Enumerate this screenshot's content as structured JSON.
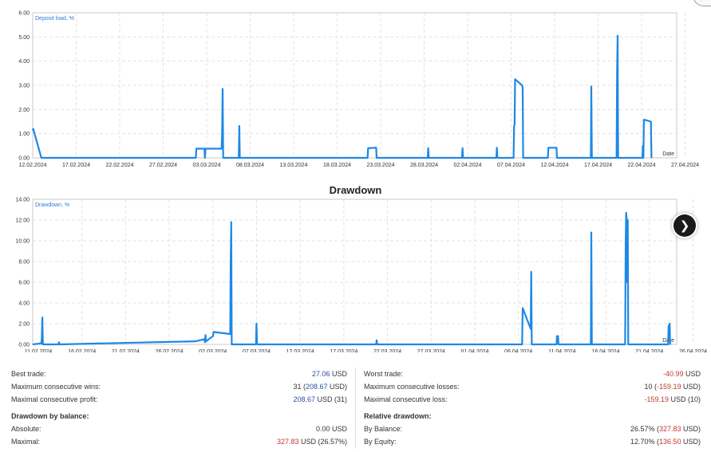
{
  "charts": {
    "deposit_load": {
      "series_label": "Deposit load, %",
      "x_axis_label": "Date",
      "y_ticks": [
        "0.00",
        "1.00",
        "2.00",
        "3.00",
        "4.00",
        "5.00",
        "6.00"
      ],
      "x_ticks": [
        "12.02.2024",
        "17.02.2024",
        "22.02.2024",
        "27.02.2024",
        "03.03.2024",
        "08.03.2024",
        "13.03.2024",
        "18.03.2024",
        "23.03.2024",
        "28.03.2024",
        "02.04.2024",
        "07.04.2024",
        "12.04.2024",
        "17.04.2024",
        "22.04.2024",
        "27.04.2024"
      ]
    },
    "drawdown": {
      "title": "Drawdown",
      "series_label": "Drawdown, %",
      "x_axis_label": "Date",
      "y_ticks": [
        "0.00",
        "2.00",
        "4.00",
        "6.00",
        "8.00",
        "10.00",
        "12.00",
        "14.00"
      ],
      "x_ticks": [
        "11.02.2024",
        "16.02.2024",
        "21.02.2024",
        "26.02.2024",
        "02.03.2024",
        "07.03.2024",
        "12.03.2024",
        "17.03.2024",
        "22.03.2024",
        "27.03.2024",
        "01.04.2024",
        "06.04.2024",
        "11.04.2024",
        "16.04.2024",
        "21.04.2024",
        "26.04.2024"
      ]
    }
  },
  "chart_data": [
    {
      "type": "line",
      "title": "",
      "series": [
        {
          "name": "Deposit load, %",
          "points": [
            [
              "12.02.2024",
              1.15
            ],
            [
              "12.02.2024",
              1.2
            ],
            [
              "13.02.2024",
              0.0
            ],
            [
              "02.03.2024",
              0.0
            ],
            [
              "02.03.2024",
              0.38
            ],
            [
              "03.03.2024",
              0.38
            ],
            [
              "03.03.2024",
              0.0
            ],
            [
              "03.03.2024",
              0.38
            ],
            [
              "05.03.2024",
              0.38
            ],
            [
              "05.03.2024",
              1.1
            ],
            [
              "05.03.2024",
              2.85
            ],
            [
              "05.03.2024",
              0.0
            ],
            [
              "07.03.2024",
              0.0
            ],
            [
              "07.03.2024",
              1.32
            ],
            [
              "07.03.2024",
              0.0
            ],
            [
              "22.03.2024",
              0.0
            ],
            [
              "22.03.2024",
              0.4
            ],
            [
              "23.03.2024",
              0.42
            ],
            [
              "23.03.2024",
              0.0
            ],
            [
              "29.03.2024",
              0.0
            ],
            [
              "29.03.2024",
              0.4
            ],
            [
              "29.03.2024",
              0.0
            ],
            [
              "02.04.2024",
              0.0
            ],
            [
              "02.04.2024",
              0.4
            ],
            [
              "02.04.2024",
              0.0
            ],
            [
              "06.04.2024",
              0.0
            ],
            [
              "06.04.2024",
              0.42
            ],
            [
              "06.04.2024",
              0.0
            ],
            [
              "08.04.2024",
              0.0
            ],
            [
              "08.04.2024",
              1.3
            ],
            [
              "08.04.2024",
              1.38
            ],
            [
              "08.04.2024",
              3.25
            ],
            [
              "09.04.2024",
              3.0
            ],
            [
              "09.04.2024",
              2.9
            ],
            [
              "09.04.2024",
              0.0
            ],
            [
              "12.04.2024",
              0.0
            ],
            [
              "12.04.2024",
              0.42
            ],
            [
              "13.04.2024",
              0.42
            ],
            [
              "13.04.2024",
              0.0
            ],
            [
              "17.04.2024",
              0.0
            ],
            [
              "17.04.2024",
              2.95
            ],
            [
              "17.04.2024",
              0.0
            ],
            [
              "20.04.2024",
              0.0
            ],
            [
              "20.04.2024",
              3.5
            ],
            [
              "20.04.2024",
              5.05
            ],
            [
              "20.04.2024",
              0.0
            ],
            [
              "23.04.2024",
              0.0
            ],
            [
              "23.04.2024",
              0.5
            ],
            [
              "23.04.2024",
              0.0
            ],
            [
              "23.04.2024",
              1.58
            ],
            [
              "24.04.2024",
              1.5
            ],
            [
              "24.04.2024",
              0.0
            ]
          ]
        }
      ],
      "xlabel": "Date",
      "ylabel": "Deposit load, %",
      "ylim": [
        0,
        6
      ],
      "xlim": [
        "12.02.2024",
        "27.04.2024"
      ],
      "grid": true
    },
    {
      "type": "line",
      "title": "Drawdown",
      "series": [
        {
          "name": "Drawdown, %",
          "points": [
            [
              "11.02.2024",
              0.0
            ],
            [
              "12.02.2024",
              0.1
            ],
            [
              "12.02.2024",
              0.6
            ],
            [
              "12.02.2024",
              2.6
            ],
            [
              "12.02.2024",
              0.0
            ],
            [
              "14.02.2024",
              0.0
            ],
            [
              "14.02.2024",
              0.2
            ],
            [
              "14.02.2024",
              0.0
            ],
            [
              "01.03.2024",
              0.3
            ],
            [
              "02.03.2024",
              0.5
            ],
            [
              "02.03.2024",
              0.2
            ],
            [
              "02.03.2024",
              0.9
            ],
            [
              "02.03.2024",
              0.3
            ],
            [
              "03.03.2024",
              0.8
            ],
            [
              "03.03.2024",
              1.2
            ],
            [
              "05.03.2024",
              1.0
            ],
            [
              "05.03.2024",
              8.0
            ],
            [
              "05.03.2024",
              11.8
            ],
            [
              "05.03.2024",
              0.0
            ],
            [
              "08.03.2024",
              0.0
            ],
            [
              "08.03.2024",
              2.0
            ],
            [
              "08.03.2024",
              0.0
            ],
            [
              "22.03.2024",
              0.0
            ],
            [
              "22.03.2024",
              0.4
            ],
            [
              "22.03.2024",
              0.0
            ],
            [
              "08.04.2024",
              0.0
            ],
            [
              "08.04.2024",
              3.5
            ],
            [
              "09.04.2024",
              1.5
            ],
            [
              "09.04.2024",
              7.0
            ],
            [
              "09.04.2024",
              0.0
            ],
            [
              "12.04.2024",
              0.0
            ],
            [
              "12.04.2024",
              0.8
            ],
            [
              "12.04.2024",
              0.3
            ],
            [
              "12.04.2024",
              0.8
            ],
            [
              "12.04.2024",
              0.0
            ],
            [
              "16.04.2024",
              0.0
            ],
            [
              "16.04.2024",
              10.8
            ],
            [
              "16.04.2024",
              0.0
            ],
            [
              "20.04.2024",
              0.0
            ],
            [
              "20.04.2024",
              10.0
            ],
            [
              "20.04.2024",
              12.7
            ],
            [
              "20.04.2024",
              12.0
            ],
            [
              "20.04.2024",
              6.0
            ],
            [
              "20.04.2024",
              12.0
            ],
            [
              "20.04.2024",
              0.0
            ],
            [
              "25.04.2024",
              0.0
            ],
            [
              "25.04.2024",
              1.8
            ],
            [
              "25.04.2024",
              1.4
            ],
            [
              "25.04.2024",
              2.0
            ],
            [
              "25.04.2024",
              0.0
            ]
          ]
        }
      ],
      "xlabel": "Date",
      "ylabel": "Drawdown, %",
      "ylim": [
        0,
        14
      ],
      "xlim": [
        "11.02.2024",
        "26.04.2024"
      ],
      "grid": true
    }
  ],
  "stats": {
    "left": [
      {
        "label": "Best trade:",
        "value": "27.06",
        "suffix": " USD",
        "value_class": "num-pos"
      },
      {
        "label": "Maximum consecutive wins:",
        "value": "31 (",
        "value2": "208.67",
        "suffix": " USD)",
        "value_class": "num-neutral",
        "value2_class": "num-pos"
      },
      {
        "label": "Maximal consecutive profit:",
        "value": "208.67",
        "suffix": " USD (31)",
        "value_class": "num-pos"
      },
      {
        "label": "Drawdown by balance:",
        "group": true
      },
      {
        "label": "Absolute:",
        "value": "0.00",
        "suffix": " USD",
        "value_class": "num-neutral"
      },
      {
        "label": "Maximal:",
        "value": "327.83",
        "suffix": " USD (26.57%)",
        "value_class": "num-neg"
      }
    ],
    "right": [
      {
        "label": "Worst trade:",
        "value": "-40.99",
        "suffix": " USD",
        "value_class": "num-neg"
      },
      {
        "label": "Maximum consecutive losses:",
        "value": "10 (",
        "value2": "-159.19",
        "suffix": " USD)",
        "value_class": "num-neutral",
        "value2_class": "num-neg"
      },
      {
        "label": "Maximal consecutive loss:",
        "value": "-159.19",
        "suffix": " USD (10)",
        "value_class": "num-neg"
      },
      {
        "label": "Relative drawdown:",
        "group": true
      },
      {
        "label": "By Balance:",
        "value": "26.57% (",
        "value2": "327.83",
        "suffix": " USD)",
        "value_class": "num-neutral",
        "value2_class": "num-neg"
      },
      {
        "label": "By Equity:",
        "value": "12.70% (",
        "value2": "136.50",
        "suffix": " USD)",
        "value_class": "num-neutral",
        "value2_class": "num-neg"
      }
    ]
  },
  "colors": {
    "line": "#1e88e5",
    "grid": "#e3e3e3",
    "frame": "#c8c8c8",
    "label": "#2d7bd6"
  },
  "icons": {
    "next": "chevron-right-icon"
  }
}
